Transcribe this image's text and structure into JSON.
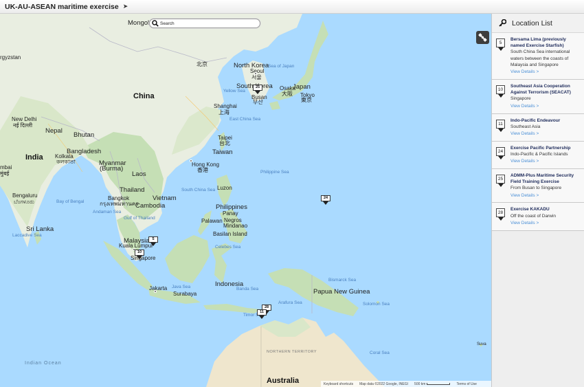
{
  "window": {
    "title": "UK-AU-ASEAN maritime exercise"
  },
  "search": {
    "placeholder": "Search"
  },
  "sidebar": {
    "title": "Location List",
    "items": [
      {
        "number": "5",
        "name": "Bersama Lima (previously named Exercise Starfish)",
        "description": "South China Sea international waters between the coasts of Malaysia and Singapore",
        "link": "View Details >"
      },
      {
        "number": "10",
        "name": "Southeast Asia Cooperation Against Terrorism (SEACAT)",
        "description": "Singapore",
        "link": "View Details >"
      },
      {
        "number": "11",
        "name": "Indo-Pacific Endeavour",
        "description": "Southeast Asia",
        "link": "View Details >"
      },
      {
        "number": "24",
        "name": "Exercise Pacific Partnership",
        "description": "Indo-Pacific & Pacific Islands",
        "link": "View Details >"
      },
      {
        "number": "25",
        "name": "ADMM-Plus Maritime Security Field Training Exercise",
        "description": "From Busan to Singapore",
        "link": "View Details >"
      },
      {
        "number": "28",
        "name": "Exercise KAKADU",
        "description": "Off the coast of Darwin",
        "link": "View Details >"
      }
    ]
  },
  "map": {
    "markers": [
      "25",
      "24",
      "5",
      "10",
      "28",
      "11"
    ],
    "labels": {
      "mongolia": "Mongoli",
      "kyrgyzstan": "rgyzstan",
      "ukazakh": "UK-AU-",
      "china": "China",
      "north_korea": "North Korea",
      "seoul": "Seoul",
      "seoul_local": "서울",
      "beijing": "北京",
      "sea_of_japan": "Sea of Japan",
      "japan": "Japan",
      "osaka": "Osaka",
      "osaka_local": "大阪",
      "tokyo": "Tokyo",
      "tokyo_local": "東京",
      "south_korea": "South Korea",
      "busan": "Busan",
      "busan_local": "부산",
      "yellow_sea": "Yellow Sea",
      "shanghai": "Shanghai",
      "shanghai_local": "上海",
      "east_china_sea": "East China Sea",
      "taipei": "Taipei",
      "taipei_local": "台北",
      "taiwan": "Taiwan",
      "new_delhi": "New Delhi",
      "new_delhi_local": "नई दिल्ली",
      "nepal": "Nepal",
      "bhutan": "Bhutan",
      "bangladesh": "Bangladesh",
      "india": "India",
      "kolkata": "Kolkata",
      "kolkata_local": "কলকাতা",
      "myanmar": "Myanmar",
      "burma": "(Burma)",
      "laos": "Laos",
      "hong_kong": "Hong Kong",
      "hong_kong_local": "香港",
      "mumbai": "mbai",
      "mumbai_local": "मुंबई",
      "thailand": "Thailand",
      "vietnam": "Vietnam",
      "south_china_sea": "South China Sea",
      "luzon": "Luzon",
      "philippine_sea": "Philippine Sea",
      "bengaluru": "Bengaluru",
      "bengaluru_local": "ಬೆಂಗಳೂರು",
      "bay_of_bengal": "Bay of Bengal",
      "bangkok": "Bangkok",
      "bangkok_local": "กรุงเทพมหานคร",
      "cambodia": "Cambodia",
      "philippines": "Philippines",
      "andaman_sea": "Andaman Sea",
      "gulf_of_thailand": "Gulf of Thailand",
      "palawan": "Palawan",
      "panay": "Panay",
      "negros": "Negros",
      "mindanao": "Mindanao",
      "sri_lanka": "Sri Lanka",
      "laccadive_sea": "Laccadive Sea",
      "basilan": "Basilan Island",
      "malaysia": "Malaysia",
      "kuala_lumpur": "Kuala Lumpur",
      "singapore": "Singapore",
      "celebes_sea": "Celebes Sea",
      "indonesia": "Indonesia",
      "java_sea": "Java Sea",
      "banda_sea": "Banda Sea",
      "jakarta": "Jakarta",
      "surabaya": "Surabaya",
      "bismarck_sea": "Bismarck Sea",
      "papua_new_guinea": "Papua New Guinea",
      "arafura_sea": "Arafura Sea",
      "solomon_sea": "Solomon Sea",
      "timor_sea": "Timor Sea",
      "northern_territory": "NORTHERN TERRITORY",
      "coral_sea": "Coral Sea",
      "suva": "Suva",
      "indian_ocean": "Indian Ocean",
      "australia": "Australia"
    },
    "attribution": {
      "shortcuts": "Keyboard shortcuts",
      "copyright": "Map data ©2022 Google, INEGI",
      "scale": "500 km",
      "terms": "Terms of Use"
    }
  },
  "colors": {
    "water": "#aadaff",
    "land": "#e9eee1",
    "green": "#c5dfb5",
    "desert": "#efe6cd",
    "link": "#4a8fd6",
    "item_name": "#1d2a5a"
  }
}
